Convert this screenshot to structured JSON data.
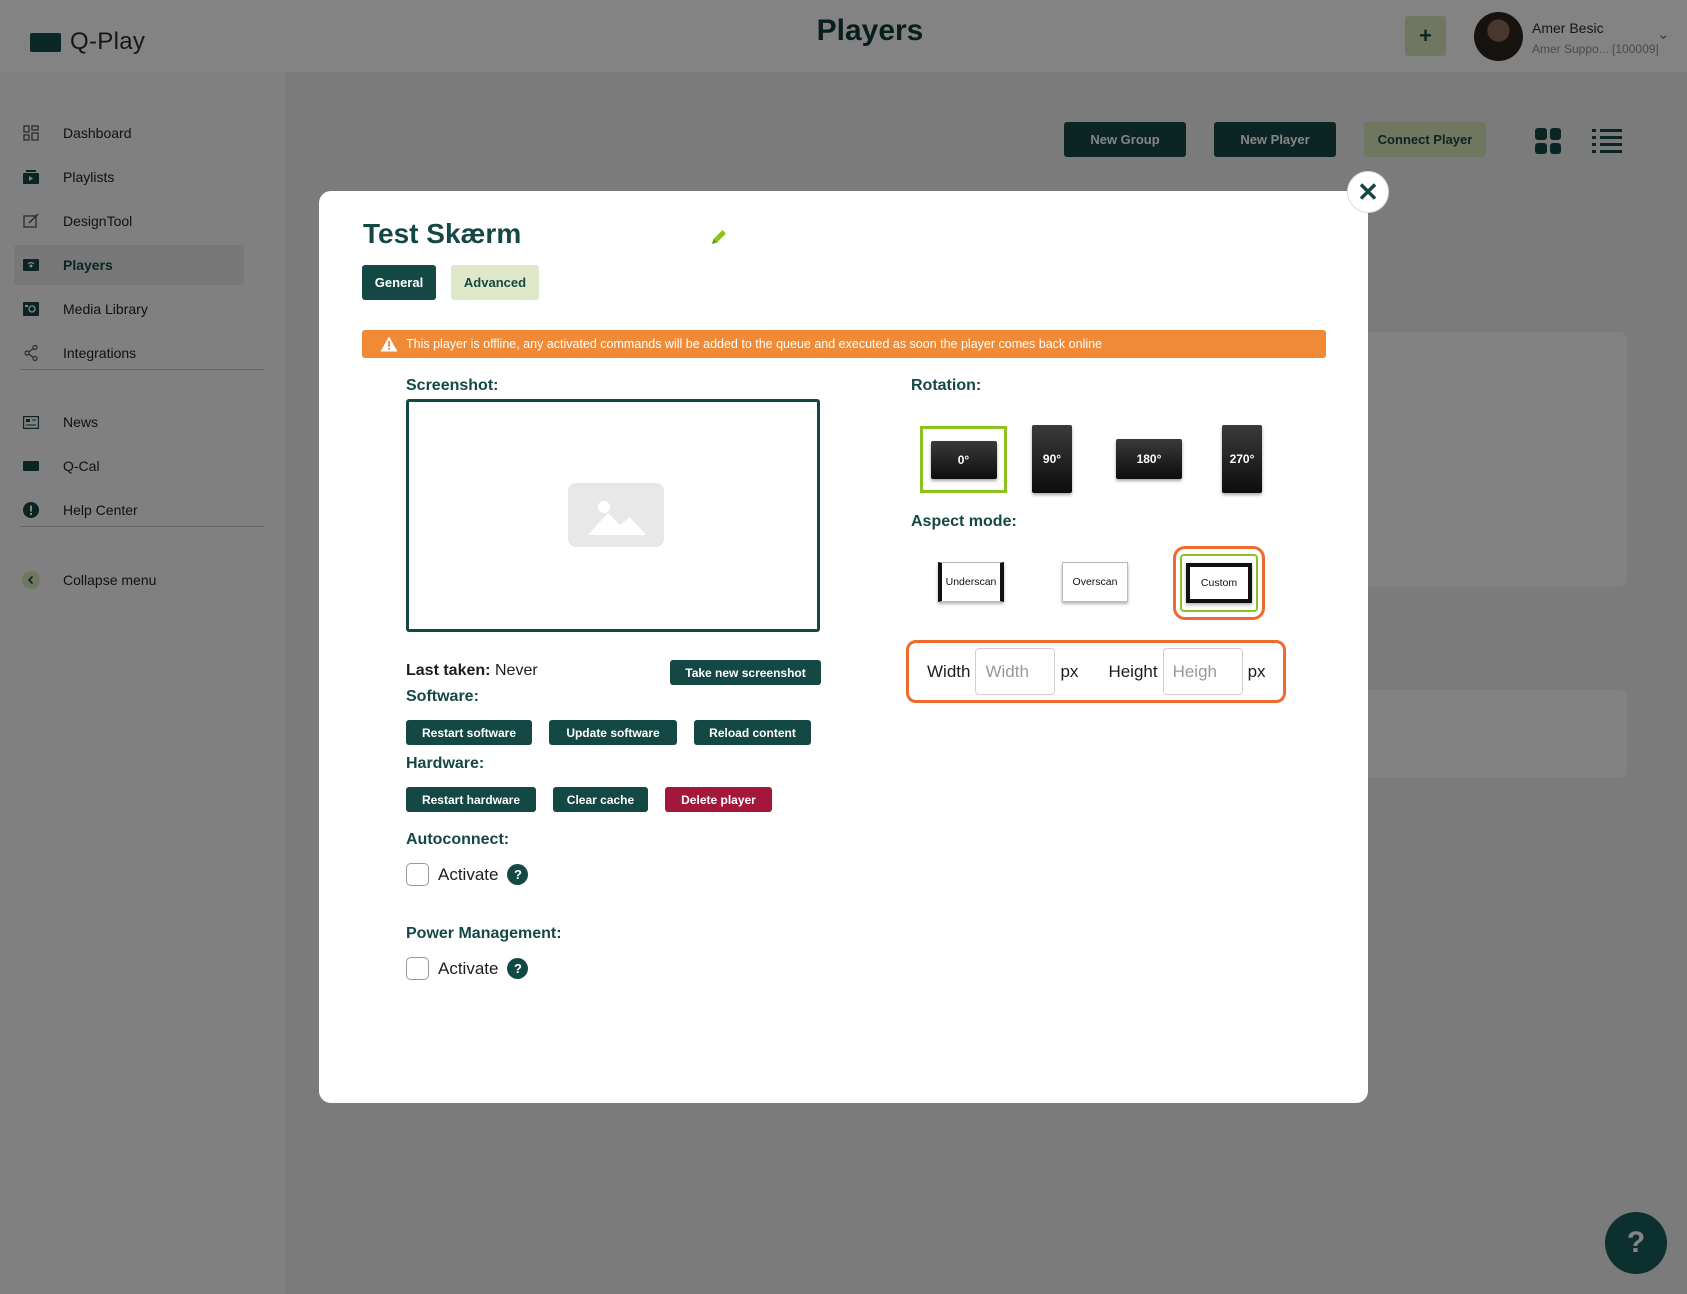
{
  "app": {
    "logo_text": "Q-Play",
    "page_title": "Players"
  },
  "header": {
    "add_label": "+",
    "user_name": "Amer Besic",
    "user_sub": "Amer Suppo... [100009]"
  },
  "sidebar": {
    "items": [
      {
        "label": "Dashboard",
        "icon": "dashboard-icon"
      },
      {
        "label": "Playlists",
        "icon": "playlists-icon"
      },
      {
        "label": "DesignTool",
        "icon": "designtool-icon"
      },
      {
        "label": "Players",
        "icon": "players-icon",
        "active": true
      },
      {
        "label": "Media Library",
        "icon": "media-library-icon"
      },
      {
        "label": "Integrations",
        "icon": "integrations-icon"
      },
      {
        "label": "News",
        "icon": "news-icon"
      },
      {
        "label": "Q-Cal",
        "icon": "qcal-icon"
      },
      {
        "label": "Help Center",
        "icon": "help-center-icon"
      },
      {
        "label": "Collapse menu",
        "icon": "collapse-icon"
      }
    ]
  },
  "toolbar": {
    "new_group": "New Group",
    "new_player": "New Player",
    "connect_player": "Connect Player"
  },
  "modal": {
    "title": "Test Skærm",
    "tabs": {
      "general": "General",
      "advanced": "Advanced"
    },
    "alert": "This player is offline, any activated commands will be added to the queue and executed as soon the player comes back online",
    "screenshot_label": "Screenshot:",
    "last_taken_label": "Last taken:",
    "last_taken_value": "Never",
    "take_screenshot": "Take new screenshot",
    "software_label": "Software:",
    "software_buttons": {
      "restart": "Restart software",
      "update": "Update software",
      "reload": "Reload content"
    },
    "hardware_label": "Hardware:",
    "hardware_buttons": {
      "restart": "Restart hardware",
      "clear": "Clear cache",
      "delete": "Delete player"
    },
    "autoconnect_label": "Autoconnect:",
    "autoconnect_activate": "Activate",
    "power_label": "Power Management:",
    "power_activate": "Activate",
    "help_glyph": "?",
    "rotation_label": "Rotation:",
    "rotations": [
      "0°",
      "90°",
      "180°",
      "270°"
    ],
    "rotation_selected": "0°",
    "aspect_label": "Aspect mode:",
    "aspects": [
      "Underscan",
      "Overscan",
      "Custom"
    ],
    "aspect_selected": "Custom",
    "width_label": "Width",
    "width_placeholder": "Width",
    "height_label": "Height",
    "height_placeholder": "Heigh",
    "unit": "px"
  },
  "help_fab": "?",
  "colors": {
    "brand": "#144845",
    "accent_light": "#d6e4b8",
    "alert": "#f08a36",
    "danger": "#a4173a",
    "selected": "#8cc21e",
    "highlight": "#f06a2e"
  }
}
